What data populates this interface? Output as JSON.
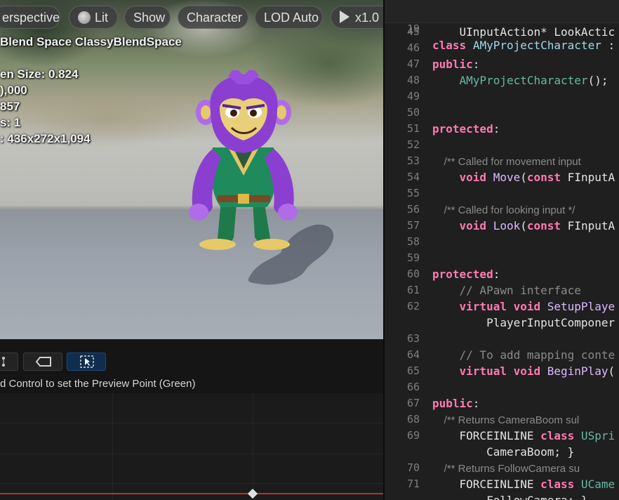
{
  "viewport": {
    "toolbar": {
      "perspective": "erspective",
      "lit": "Lit",
      "show": "Show",
      "character": "Character",
      "lod": "LOD Auto",
      "speed": "x1.0"
    },
    "stats": {
      "blend_space": "Blend Space ClassyBlendSpace",
      "screen_size": "en Size: 0.824",
      "line2": "),000",
      "line3": "857",
      "line4": "s: 1",
      "line5": ": 436x272x1,094"
    }
  },
  "blend_editor": {
    "hint": "d Control to set the Preview Point (Green)"
  },
  "code_editor": {
    "sticky": {
      "ln": "19",
      "kw": "class",
      "name": "AMyProjectCharacter",
      "rest": " :"
    },
    "lines": [
      {
        "ln": "45",
        "a": "    UInputAction* LookActic"
      },
      {
        "ln": "46"
      },
      {
        "ln": "47",
        "kw": "public",
        "rest": ":"
      },
      {
        "ln": "48",
        "ty": "    AMyProjectCharacter",
        "rest": "();"
      },
      {
        "ln": "49"
      },
      {
        "ln": "50"
      },
      {
        "ln": "51",
        "kw": "protected",
        "rest": ":"
      },
      {
        "ln": "52"
      },
      {
        "ln": "53",
        "cm": "    /** Called for movement input"
      },
      {
        "ln": "54",
        "kw": "    void",
        "fn": " Move",
        "rest": "(",
        "kw2": "const",
        "rest2": " FInputA"
      },
      {
        "ln": "55"
      },
      {
        "ln": "56",
        "cm": "    /** Called for looking input */"
      },
      {
        "ln": "57",
        "kw": "    void",
        "fn": " Look",
        "rest": "(",
        "kw2": "const",
        "rest2": " FInputA"
      },
      {
        "ln": "58"
      },
      {
        "ln": "59"
      },
      {
        "ln": "60",
        "kw": "protected",
        "rest": ":"
      },
      {
        "ln": "61",
        "cm2": "    // APawn interface"
      },
      {
        "ln": "62",
        "kw": "    virtual void",
        "fn": " SetupPlaye"
      },
      {
        "ln": "",
        "a": "        PlayerInputComponer"
      },
      {
        "ln": "63"
      },
      {
        "ln": "64",
        "cm2": "    // To add mapping conte"
      },
      {
        "ln": "65",
        "kw": "    virtual void",
        "fn": " BeginPlay",
        "rest": "("
      },
      {
        "ln": "66"
      },
      {
        "ln": "67",
        "kw": "public",
        "rest": ":"
      },
      {
        "ln": "68",
        "cm": "    /** Returns CameraBoom sul"
      },
      {
        "ln": "69",
        "a": "    FORCEINLINE ",
        "kw": "class",
        "ty": " USpri"
      },
      {
        "ln": "",
        "a": "        CameraBoom; }"
      },
      {
        "ln": "70",
        "cm": "    /** Returns FollowCamera su"
      },
      {
        "ln": "71",
        "a": "    FORCEINLINE ",
        "kw": "class",
        "ty": " UCame"
      },
      {
        "ln": "",
        "a": "        FollowCamera; }"
      }
    ]
  }
}
